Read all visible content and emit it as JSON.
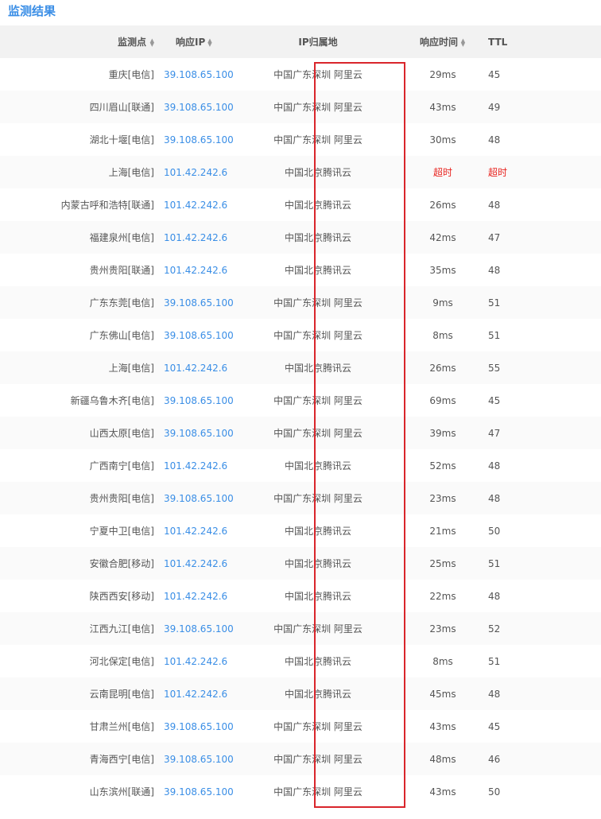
{
  "page": {
    "title": "监测结果"
  },
  "table": {
    "headers": {
      "point": "监测点",
      "ip": "响应IP",
      "location": "IP归属地",
      "time": "响应时间",
      "ttl": "TTL"
    },
    "rows": [
      {
        "point": "重庆[电信]",
        "ip": "39.108.65.100",
        "location": "中国广东深圳 阿里云",
        "time": "29ms",
        "ttl": "45"
      },
      {
        "point": "四川眉山[联通]",
        "ip": "39.108.65.100",
        "location": "中国广东深圳 阿里云",
        "time": "43ms",
        "ttl": "49"
      },
      {
        "point": "湖北十堰[电信]",
        "ip": "39.108.65.100",
        "location": "中国广东深圳 阿里云",
        "time": "30ms",
        "ttl": "48"
      },
      {
        "point": "上海[电信]",
        "ip": "101.42.242.6",
        "location": "中国北京腾讯云",
        "time": "超时",
        "ttl": "超时",
        "timeout": true
      },
      {
        "point": "内蒙古呼和浩特[联通]",
        "ip": "101.42.242.6",
        "location": "中国北京腾讯云",
        "time": "26ms",
        "ttl": "48"
      },
      {
        "point": "福建泉州[电信]",
        "ip": "101.42.242.6",
        "location": "中国北京腾讯云",
        "time": "42ms",
        "ttl": "47"
      },
      {
        "point": "贵州贵阳[联通]",
        "ip": "101.42.242.6",
        "location": "中国北京腾讯云",
        "time": "35ms",
        "ttl": "48"
      },
      {
        "point": "广东东莞[电信]",
        "ip": "39.108.65.100",
        "location": "中国广东深圳 阿里云",
        "time": "9ms",
        "ttl": "51"
      },
      {
        "point": "广东佛山[电信]",
        "ip": "39.108.65.100",
        "location": "中国广东深圳 阿里云",
        "time": "8ms",
        "ttl": "51"
      },
      {
        "point": "上海[电信]",
        "ip": "101.42.242.6",
        "location": "中国北京腾讯云",
        "time": "26ms",
        "ttl": "55"
      },
      {
        "point": "新疆乌鲁木齐[电信]",
        "ip": "39.108.65.100",
        "location": "中国广东深圳 阿里云",
        "time": "69ms",
        "ttl": "45"
      },
      {
        "point": "山西太原[电信]",
        "ip": "39.108.65.100",
        "location": "中国广东深圳 阿里云",
        "time": "39ms",
        "ttl": "47"
      },
      {
        "point": "广西南宁[电信]",
        "ip": "101.42.242.6",
        "location": "中国北京腾讯云",
        "time": "52ms",
        "ttl": "48"
      },
      {
        "point": "贵州贵阳[电信]",
        "ip": "39.108.65.100",
        "location": "中国广东深圳 阿里云",
        "time": "23ms",
        "ttl": "48"
      },
      {
        "point": "宁夏中卫[电信]",
        "ip": "101.42.242.6",
        "location": "中国北京腾讯云",
        "time": "21ms",
        "ttl": "50"
      },
      {
        "point": "安徽合肥[移动]",
        "ip": "101.42.242.6",
        "location": "中国北京腾讯云",
        "time": "25ms",
        "ttl": "51"
      },
      {
        "point": "陕西西安[移动]",
        "ip": "101.42.242.6",
        "location": "中国北京腾讯云",
        "time": "22ms",
        "ttl": "48"
      },
      {
        "point": "江西九江[电信]",
        "ip": "39.108.65.100",
        "location": "中国广东深圳 阿里云",
        "time": "23ms",
        "ttl": "52"
      },
      {
        "point": "河北保定[电信]",
        "ip": "101.42.242.6",
        "location": "中国北京腾讯云",
        "time": "8ms",
        "ttl": "51"
      },
      {
        "point": "云南昆明[电信]",
        "ip": "101.42.242.6",
        "location": "中国北京腾讯云",
        "time": "45ms",
        "ttl": "48"
      },
      {
        "point": "甘肃兰州[电信]",
        "ip": "39.108.65.100",
        "location": "中国广东深圳 阿里云",
        "time": "43ms",
        "ttl": "45"
      },
      {
        "point": "青海西宁[电信]",
        "ip": "39.108.65.100",
        "location": "中国广东深圳 阿里云",
        "time": "48ms",
        "ttl": "46"
      },
      {
        "point": "山东滨州[联通]",
        "ip": "39.108.65.100",
        "location": "中国广东深圳 阿里云",
        "time": "43ms",
        "ttl": "50"
      }
    ]
  },
  "icons": {
    "sort": "sort-updown-icon"
  },
  "colors": {
    "accent": "#3a8ee6",
    "timeout": "#e8231f",
    "highlight_border": "#d9252b",
    "header_bg": "#f2f2f2"
  }
}
